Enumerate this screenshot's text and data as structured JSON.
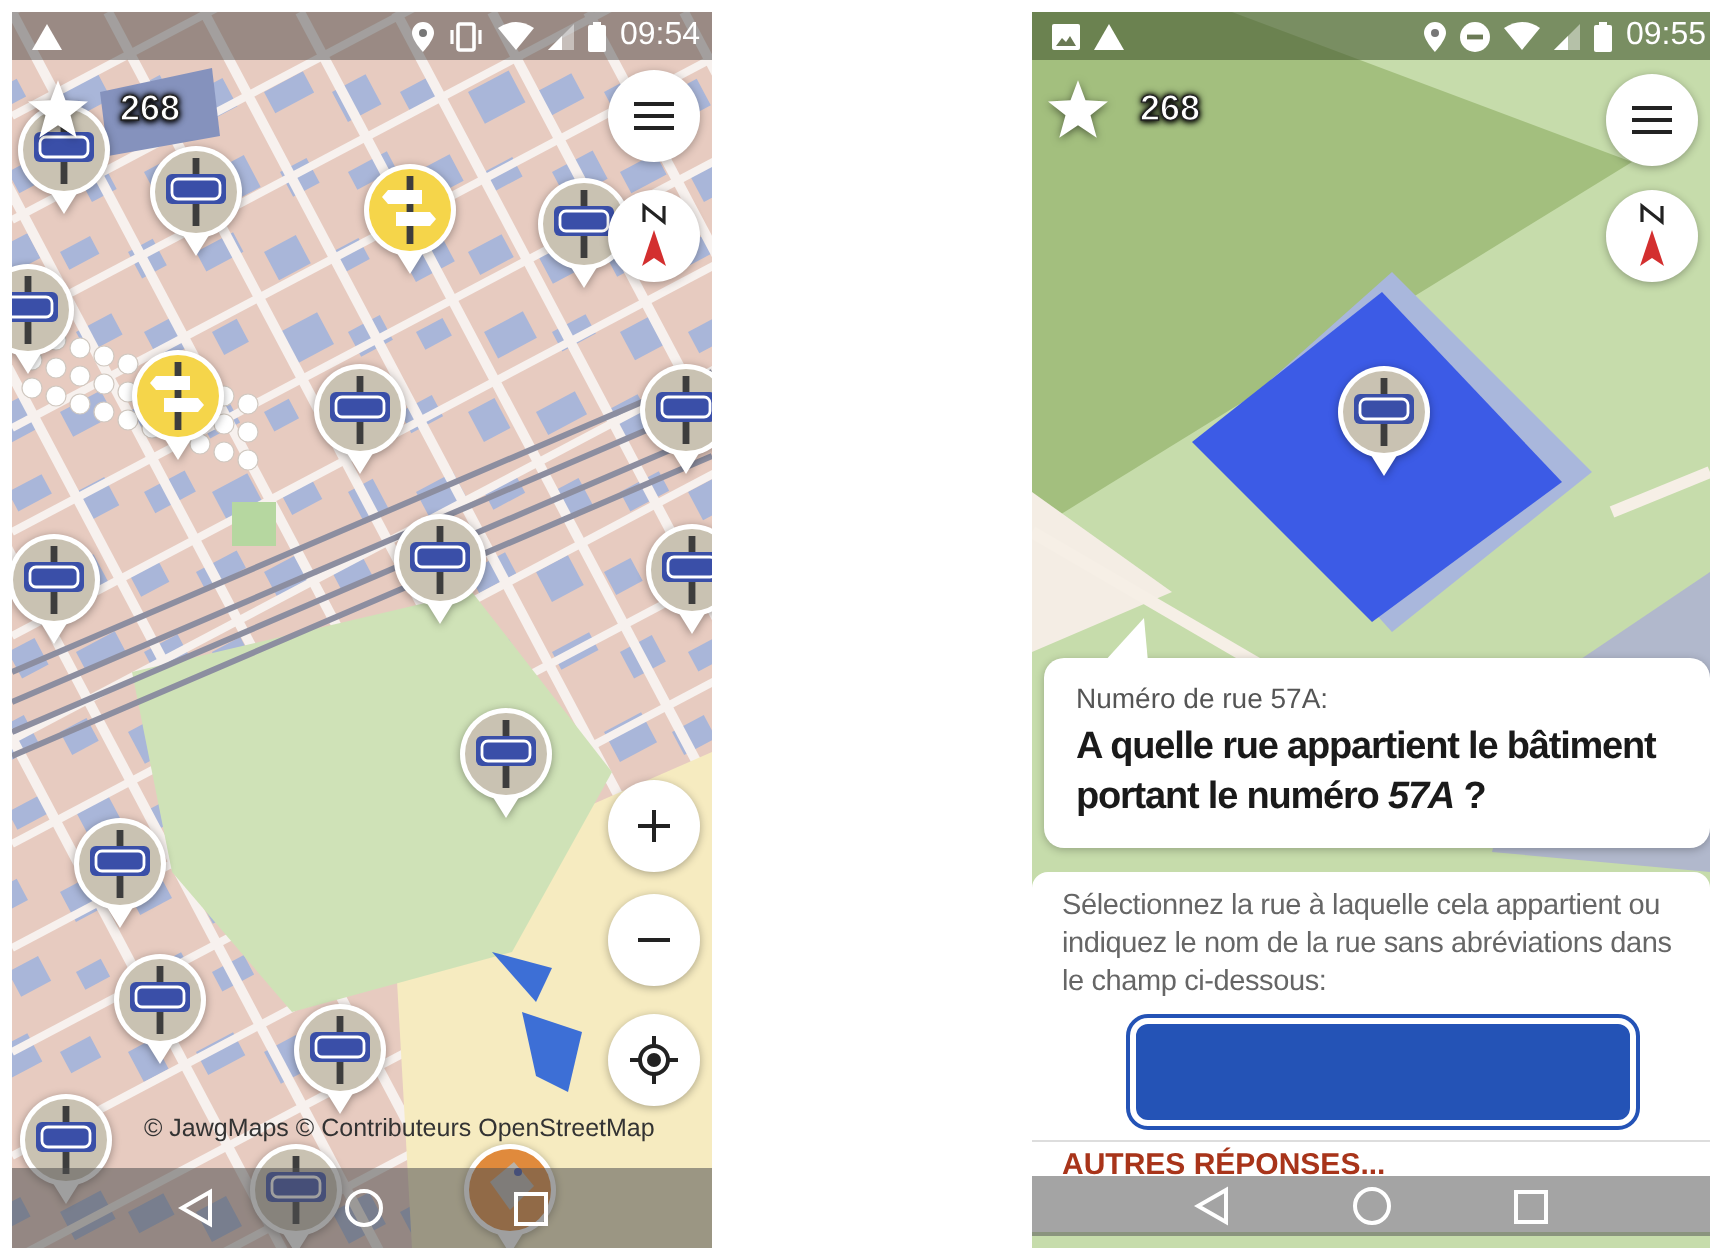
{
  "screens": [
    {
      "kind": "map",
      "status_bar": {
        "time": "09:54"
      },
      "score": "268",
      "attribution": "© JawgMaps © Contributeurs OpenStreetMap"
    },
    {
      "kind": "quest",
      "status_bar": {
        "time": "09:55"
      },
      "score": "268",
      "quest": {
        "subtitle": "Numéro de rue 57A:",
        "title": "A quelle rue appartient le bâtiment portant le numéro *57A* ?",
        "instructions": "Sélectionnez la rue à laquelle cela appartient ou indiquez le nom de la rue sans abréviations dans le champ ci-dessous:",
        "other_answers": "AUTRES RÉPONSES..."
      }
    }
  ]
}
